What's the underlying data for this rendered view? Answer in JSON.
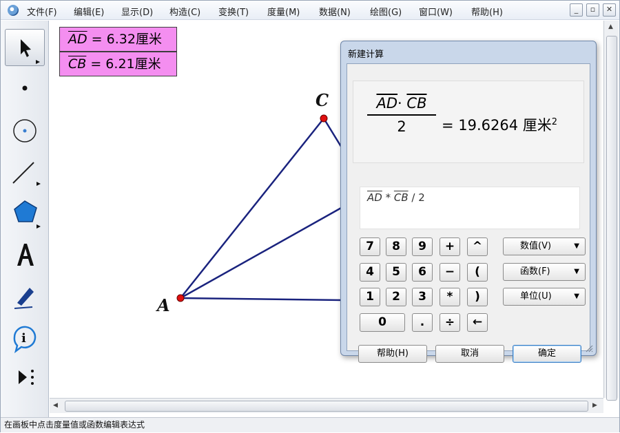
{
  "menu": [
    "文件(F)",
    "编辑(E)",
    "显示(D)",
    "构造(C)",
    "变换(T)",
    "度量(M)",
    "数据(N)",
    "绘图(G)",
    "窗口(W)",
    "帮助(H)"
  ],
  "window_controls": {
    "minimize": "_",
    "restore": "▫",
    "close": "✕"
  },
  "tools": [
    "arrow-select-tool",
    "point-tool",
    "compass-tool",
    "line-tool",
    "polygon-tool",
    "text-tool",
    "marker-tool",
    "info-tool",
    "custom-tool"
  ],
  "measurements": [
    {
      "segment": "AD",
      "equals": " = 6.32厘米"
    },
    {
      "segment": "CB",
      "equals": " = 6.21厘米"
    }
  ],
  "points": {
    "A": "A",
    "C": "C"
  },
  "dialog": {
    "title": "新建计算",
    "result": {
      "numerator": "AD· CB",
      "num_part1": "AD",
      "num_dot": "· ",
      "num_part2": "CB",
      "denominator": "2",
      "value": "= 19.6264 厘米",
      "superscript": "2"
    },
    "expression": {
      "part1": "AD",
      "op1": " * ",
      "part2": "CB",
      "op2": " / 2"
    },
    "keys": {
      "row1": [
        "7",
        "8",
        "9",
        "+",
        "^"
      ],
      "row2": [
        "4",
        "5",
        "6",
        "−",
        "("
      ],
      "row3": [
        "1",
        "2",
        "3",
        "*",
        ")"
      ],
      "row4": [
        "0",
        ".",
        "÷",
        "←"
      ]
    },
    "dropdowns": [
      "数值(V)",
      "函数(F)",
      "单位(U)"
    ],
    "buttons": {
      "help": "帮助(H)",
      "cancel": "取消",
      "ok": "确定"
    }
  },
  "status": "在画板中点击度量值或函数编辑表达式",
  "colors": {
    "measurement_bg": "#f48ef0",
    "segment": "#1a237e",
    "point": "#e01010",
    "dialog_frame": "#c9d7ea"
  }
}
